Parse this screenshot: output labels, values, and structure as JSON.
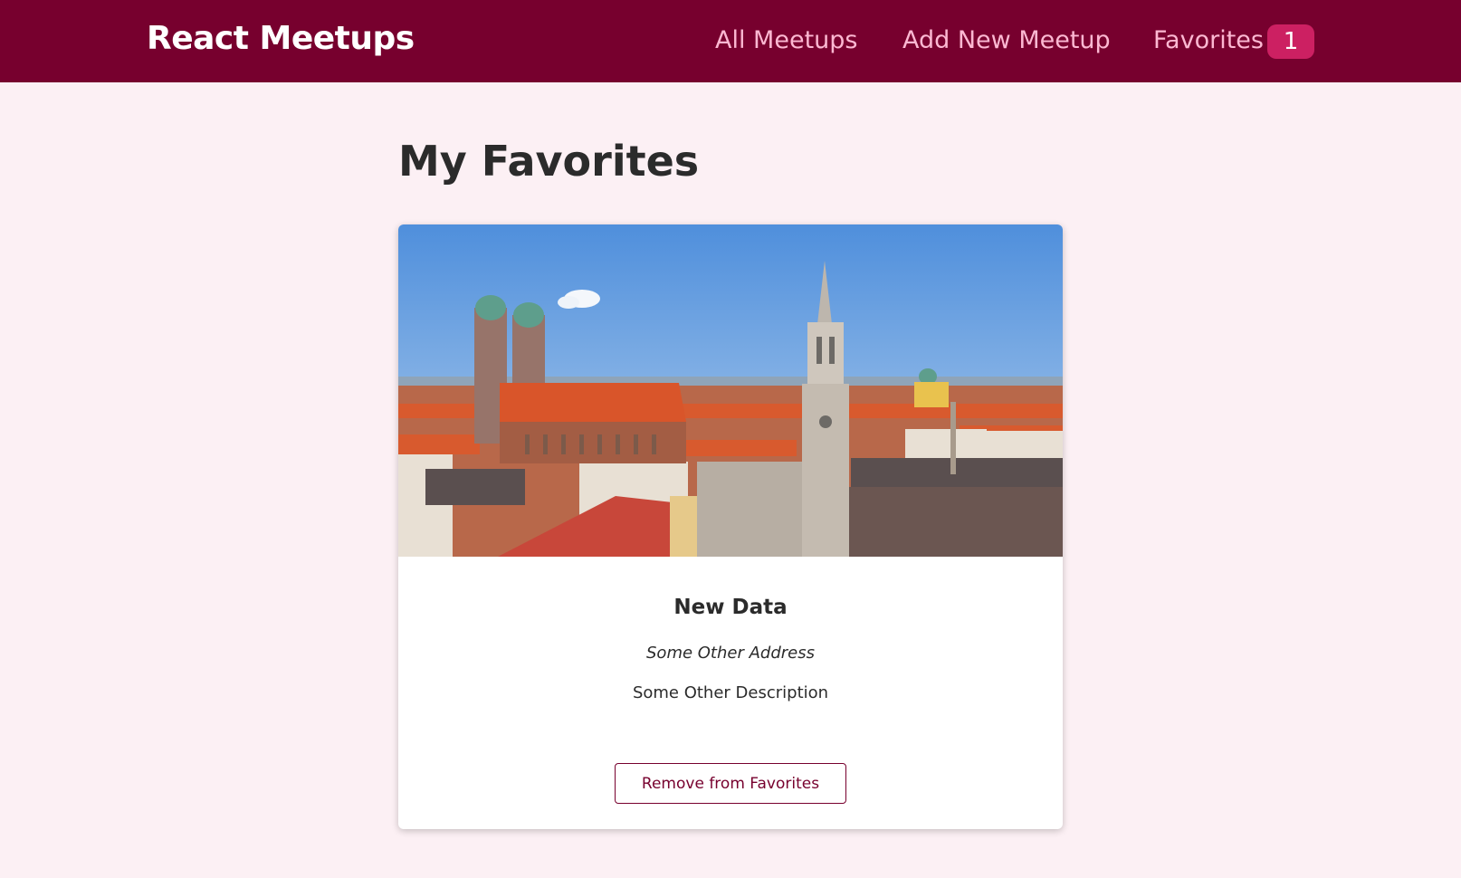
{
  "header": {
    "logo": "React Meetups",
    "nav": {
      "all_meetups": "All Meetups",
      "add_new_meetup": "Add New Meetup",
      "favorites": "Favorites",
      "favorites_count": "1"
    }
  },
  "main": {
    "title": "My Favorites",
    "meetups": [
      {
        "title": "New Data",
        "address": "Some Other Address",
        "description": "Some Other Description",
        "action_label": "Remove from Favorites",
        "image": "munich-city-skyline"
      }
    ]
  },
  "colors": {
    "header_bg": "#77002e",
    "nav_link": "#fcb8d2",
    "badge_bg": "#cc2062",
    "page_bg": "#fcf0f4",
    "button_accent": "#77002e"
  }
}
